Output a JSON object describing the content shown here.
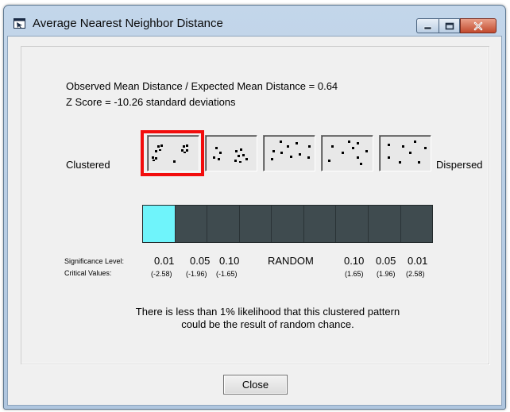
{
  "window": {
    "title": "Average Nearest Neighbor Distance",
    "colors": {
      "frame": "#b6cbe2",
      "client": "#f0f0f0",
      "close_btn": "#c24a2e"
    }
  },
  "results": {
    "ratio_line": "Observed Mean Distance / Expected Mean Distance = 0.64",
    "zscore_line": "Z Score = -10.26 standard deviations"
  },
  "patterns": {
    "left_label": "Clustered",
    "right_label": "Dispersed",
    "items": [
      {
        "name": "clustered",
        "icon": "clustered-points-icon",
        "selected": true
      },
      {
        "name": "somewhat-clustered",
        "icon": "somewhat-clustered-points-icon",
        "selected": false
      },
      {
        "name": "random",
        "icon": "random-points-icon",
        "selected": false
      },
      {
        "name": "somewhat-dispersed",
        "icon": "somewhat-dispersed-points-icon",
        "selected": false
      },
      {
        "name": "dispersed",
        "icon": "dispersed-points-icon",
        "selected": false
      }
    ]
  },
  "scale": {
    "segments": 9,
    "active_segment_index": 0,
    "active_color": "#6ff4fb",
    "inactive_color": "#3f4b4f",
    "significance_label": "Significance Level:",
    "critical_label": "Critical Values:",
    "significance_levels": [
      "0.01",
      "0.05",
      "0.10",
      "RANDOM",
      "0.10",
      "0.05",
      "0.01"
    ],
    "critical_values": [
      "(-2.58)",
      "(-1.96)",
      "(-1.65)",
      "(1.65)",
      "(1.96)",
      "(2.58)"
    ]
  },
  "interpretation": {
    "line1": "There is less than 1% likelihood that this clustered pattern",
    "line2": "could be the result of random chance."
  },
  "buttons": {
    "close_label": "Close"
  }
}
